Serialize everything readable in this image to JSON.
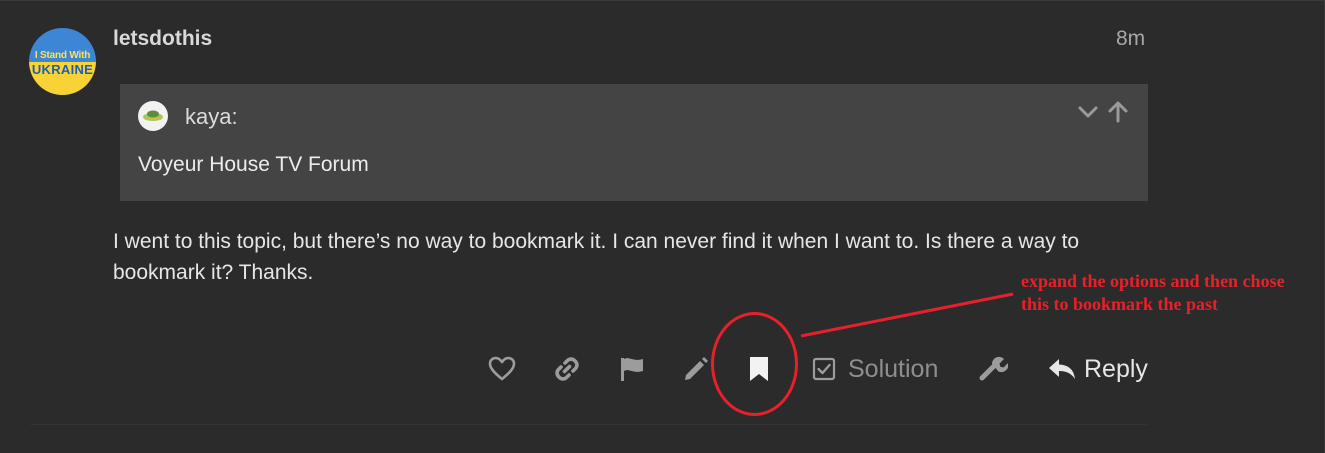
{
  "post": {
    "username": "letsdothis",
    "date": "8m",
    "avatar": {
      "line1": "I Stand With",
      "line2": "UKRAINE",
      "colors": {
        "top": "#3d86d6",
        "bottom": "#f7d335"
      }
    },
    "quote": {
      "username": "kaya:",
      "text": "Voyeur House TV Forum",
      "controls": [
        "chevron-down-icon",
        "arrow-up-icon"
      ]
    },
    "body": "I went to this topic, but there’s no way to bookmark it. I can never find it when I want to. Is there a way to bookmark it? Thanks."
  },
  "actions": {
    "icons": [
      "heart-icon",
      "link-icon",
      "flag-icon",
      "pencil-icon",
      "bookmark-icon",
      "checkbox-icon",
      "wrench-icon",
      "reply-icon"
    ],
    "solution_label": "Solution",
    "reply_label": "Reply"
  },
  "annotation": {
    "text_line1": "expand the options and then chose",
    "text_line2": "this to bookmark the past",
    "color": "#e8202a"
  }
}
